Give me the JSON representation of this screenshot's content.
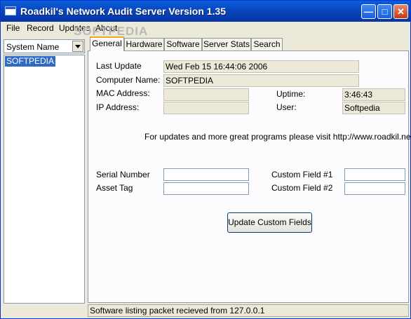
{
  "window": {
    "title": "Roadkil's Network Audit Server Version 1.35",
    "watermark": "SOFTPEDIA",
    "controls": {
      "minimize": "—",
      "maximize": "□",
      "close": "✕"
    }
  },
  "menu": {
    "items": [
      "File",
      "Record",
      "Updates",
      "About"
    ]
  },
  "sidebar": {
    "combo_value": "System Name",
    "list_items": [
      "SOFTPEDIA"
    ]
  },
  "tabs": [
    "General",
    "Hardware",
    "Software",
    "Server Stats",
    "Search"
  ],
  "general": {
    "last_update_label": "Last Update",
    "last_update_value": "Wed Feb 15 16:44:06 2006",
    "computer_name_label": "Computer Name:",
    "computer_name_value": "SOFTPEDIA",
    "mac_label": "MAC Address:",
    "mac_value": "",
    "ip_label": "IP Address:",
    "ip_value": "",
    "uptime_label": "Uptime:",
    "uptime_value": "3:46:43",
    "user_label": "User:",
    "user_value": "Softpedia",
    "info_text": "For updates and more great programs please visit http://www.roadkil.net !",
    "serial_label": "Serial Number",
    "serial_value": "",
    "asset_label": "Asset Tag",
    "asset_value": "",
    "custom1_label": "Custom Field #1",
    "custom1_value": "",
    "custom2_label": "Custom Field #2",
    "custom2_value": "",
    "update_button": "Update Custom Fields"
  },
  "status": {
    "text": "Software listing packet recieved from 127.0.0.1"
  }
}
